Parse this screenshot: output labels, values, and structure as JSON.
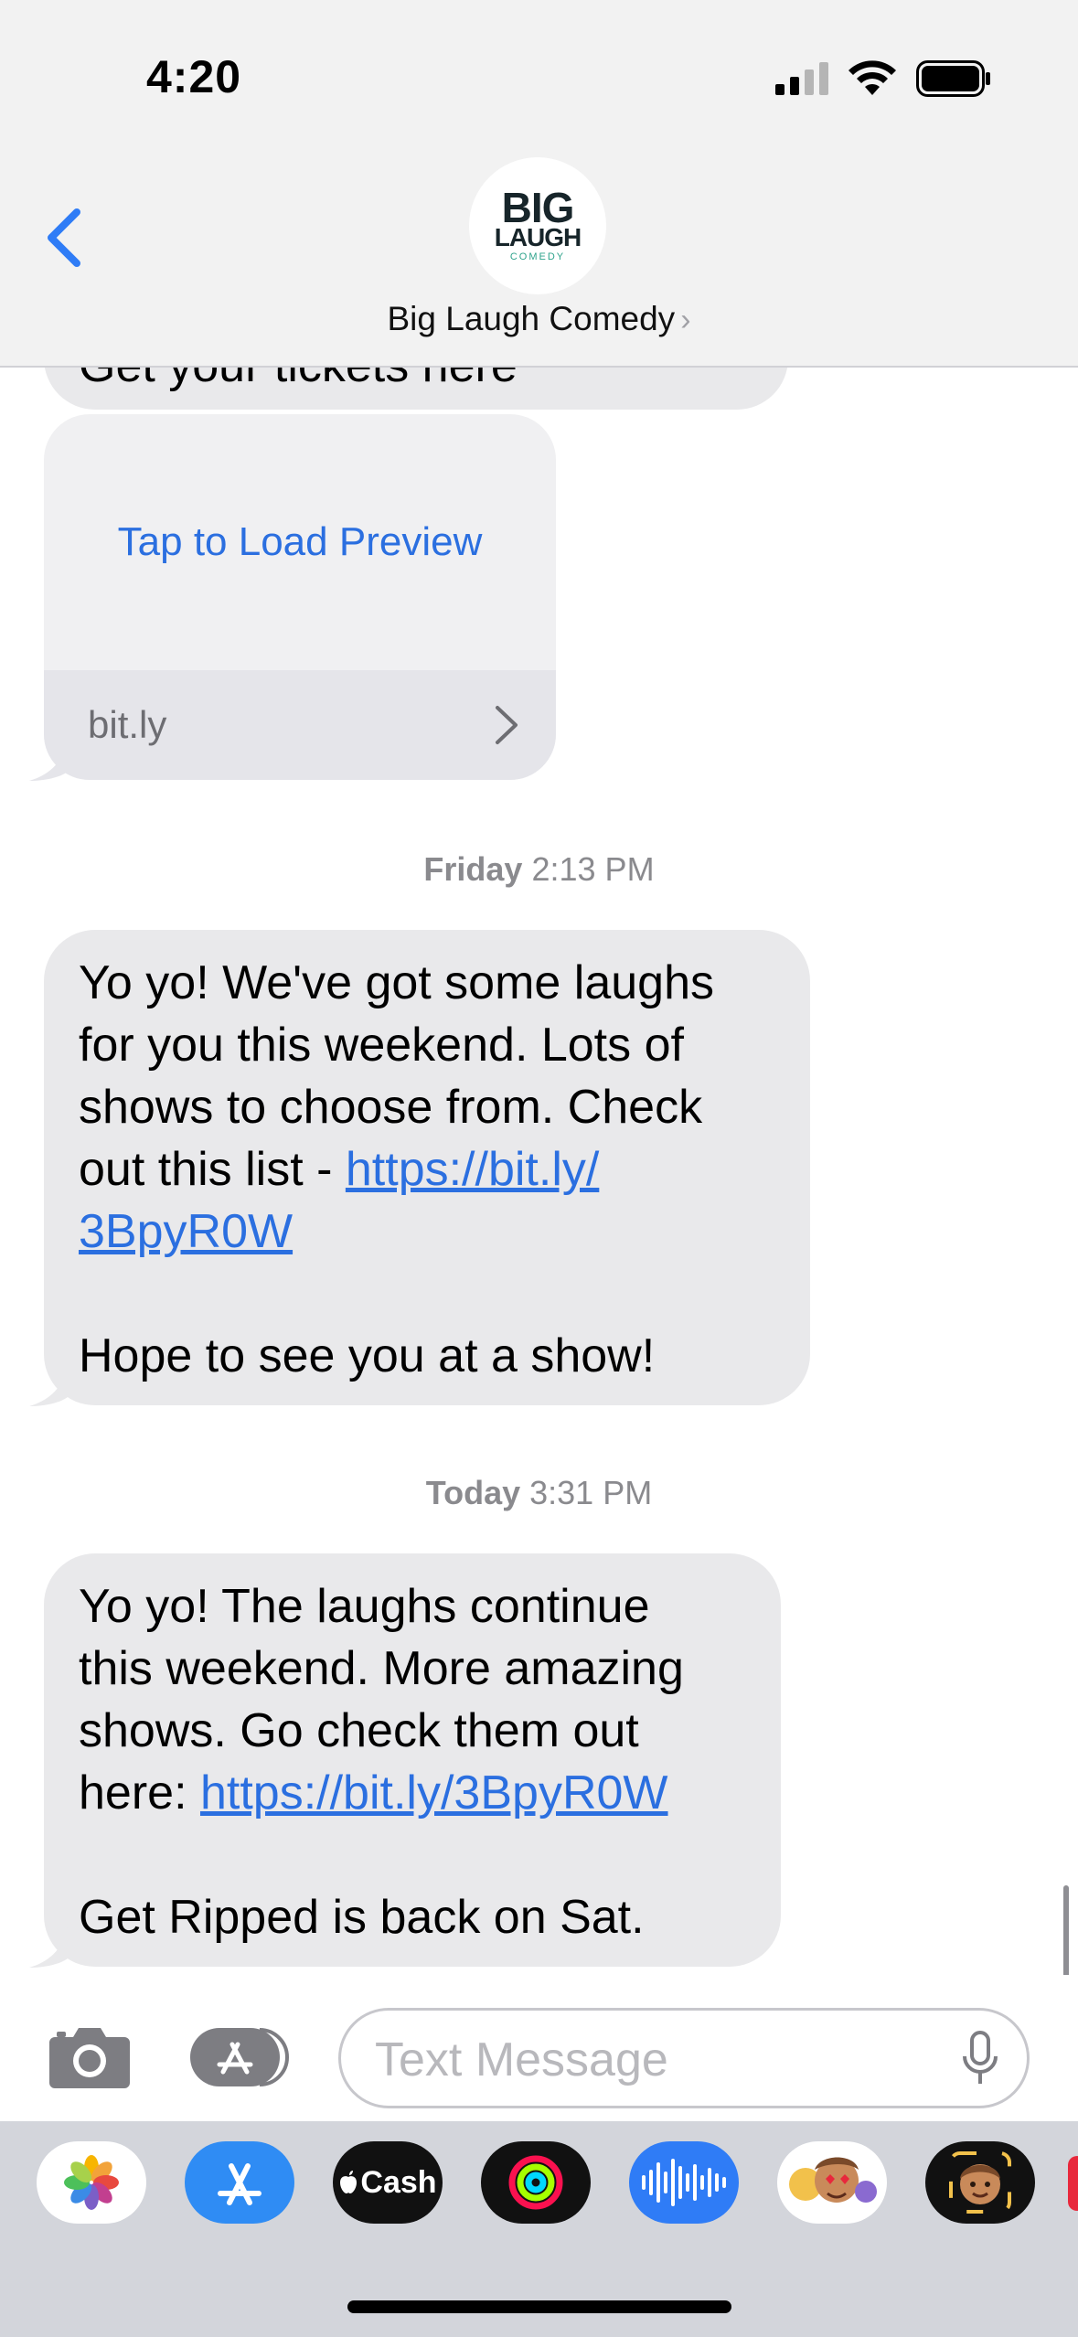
{
  "status_bar": {
    "time": "4:20"
  },
  "header": {
    "contact_name": "Big Laugh Comedy",
    "logo": {
      "line1": "BIG",
      "line2": "LAUGH",
      "line3": "COMEDY"
    }
  },
  "messages": {
    "partial_top_text": "Get your tickets here",
    "preview": {
      "tap_label": "Tap to Load Preview",
      "domain": "bit.ly"
    },
    "stamp1": {
      "day": "Friday",
      "time": "2:13 PM"
    },
    "msg1": {
      "line1": "Yo yo! We've got some laughs",
      "line2": "for you this weekend. Lots of",
      "line3": "shows to choose from. Check",
      "line4_prefix": "out this list - ",
      "link_part1": "https://bit.ly/",
      "link_part2": "3BpyR0W",
      "line_last": "Hope to see you at a show!"
    },
    "stamp2": {
      "day": "Today",
      "time": "3:31 PM"
    },
    "msg2": {
      "line1": "Yo yo! The laughs continue",
      "line2": "this weekend. More amazing",
      "line3": "shows. Go check them out",
      "line4_prefix": "here: ",
      "link": "https://bit.ly/3BpyR0W",
      "line_last": "Get Ripped is back on Sat."
    }
  },
  "composer": {
    "placeholder": "Text Message"
  },
  "app_drawer": {
    "apps": [
      {
        "name": "photos",
        "icon": "photos-icon"
      },
      {
        "name": "app-store",
        "icon": "app-store-icon"
      },
      {
        "name": "apple-cash",
        "icon": "apple-cash-icon",
        "label": "Cash"
      },
      {
        "name": "fitness",
        "icon": "activity-rings-icon"
      },
      {
        "name": "audio-message",
        "icon": "waveform-icon"
      },
      {
        "name": "memoji-stickers",
        "icon": "memoji-stickers-icon"
      },
      {
        "name": "memoji",
        "icon": "memoji-icon"
      }
    ]
  },
  "colors": {
    "link": "#2b6fe0",
    "bubble": "#e9e9eb",
    "accent_blue": "#2f7cf6"
  }
}
